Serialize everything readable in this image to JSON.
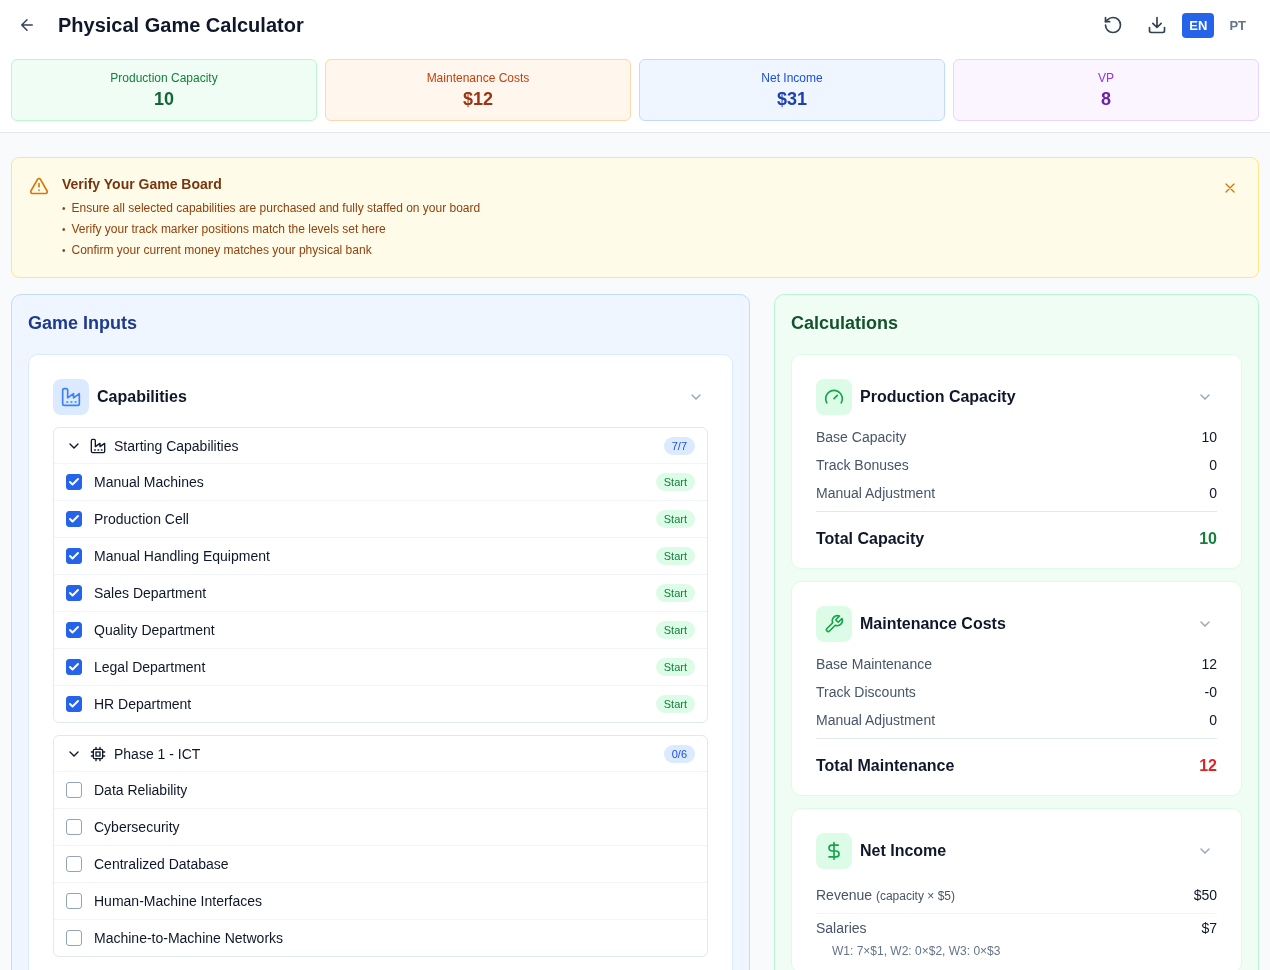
{
  "header": {
    "title": "Physical Game Calculator",
    "languages": [
      {
        "label": "EN",
        "selected": true
      },
      {
        "label": "PT",
        "selected": false
      }
    ]
  },
  "stats": [
    {
      "label": "Production Capacity",
      "value": "10",
      "kind": "green"
    },
    {
      "label": "Maintenance Costs",
      "value": "$12",
      "kind": "orange"
    },
    {
      "label": "Net Income",
      "value": "$31",
      "kind": "blue"
    },
    {
      "label": "VP",
      "value": "8",
      "kind": "purple"
    }
  ],
  "alert": {
    "title": "Verify Your Game Board",
    "marker": "•",
    "items": [
      "Ensure all selected capabilities are purchased and fully staffed on your board",
      "Verify your track marker positions match the levels set here",
      "Confirm your current money matches your physical bank"
    ]
  },
  "inputs": {
    "title": "Game Inputs",
    "section": {
      "title": "Capabilities",
      "groups": [
        {
          "title": "Starting Capabilities",
          "count": "7/7",
          "kind": "factory",
          "expanded": true,
          "items": [
            {
              "label": "Manual Machines",
              "checked": true,
              "badge": "Start"
            },
            {
              "label": "Production Cell",
              "checked": true,
              "badge": "Start"
            },
            {
              "label": "Manual Handling Equipment",
              "checked": true,
              "badge": "Start"
            },
            {
              "label": "Sales Department",
              "checked": true,
              "badge": "Start"
            },
            {
              "label": "Quality Department",
              "checked": true,
              "badge": "Start"
            },
            {
              "label": "Legal Department",
              "checked": true,
              "badge": "Start"
            },
            {
              "label": "HR Department",
              "checked": true,
              "badge": "Start"
            }
          ]
        },
        {
          "title": "Phase 1 - ICT",
          "count": "0/6",
          "kind": "chip",
          "expanded": true,
          "items": [
            {
              "label": "Data Reliability",
              "checked": false
            },
            {
              "label": "Cybersecurity",
              "checked": false
            },
            {
              "label": "Centralized Database",
              "checked": false
            },
            {
              "label": "Human-Machine Interfaces",
              "checked": false
            },
            {
              "label": "Machine-to-Machine Networks",
              "checked": false
            }
          ]
        }
      ]
    }
  },
  "calculations": {
    "title": "Calculations",
    "sections": [
      {
        "title": "Production Capacity",
        "kind": "gauge",
        "rows": [
          {
            "label": "Base Capacity",
            "value": "10"
          },
          {
            "label": "Track Bonuses",
            "value": "0"
          },
          {
            "label": "Manual Adjustment",
            "value": "0"
          }
        ],
        "total": {
          "label": "Total Capacity",
          "value": "10",
          "kind": "green"
        }
      },
      {
        "title": "Maintenance Costs",
        "kind": "wrench",
        "rows": [
          {
            "label": "Base Maintenance",
            "value": "12"
          },
          {
            "label": "Track Discounts",
            "value": "-0"
          },
          {
            "label": "Manual Adjustment",
            "value": "0"
          }
        ],
        "total": {
          "label": "Total Maintenance",
          "value": "12",
          "kind": "red"
        }
      },
      {
        "title": "Net Income",
        "kind": "dollar",
        "rows": [
          {
            "label": "Revenue",
            "note": "(capacity × $5)",
            "value": "$50"
          },
          {
            "label": "Salaries",
            "value": "$7",
            "detail": "W1: 7×$1, W2: 0×$2, W3: 0×$3"
          }
        ]
      }
    ]
  }
}
